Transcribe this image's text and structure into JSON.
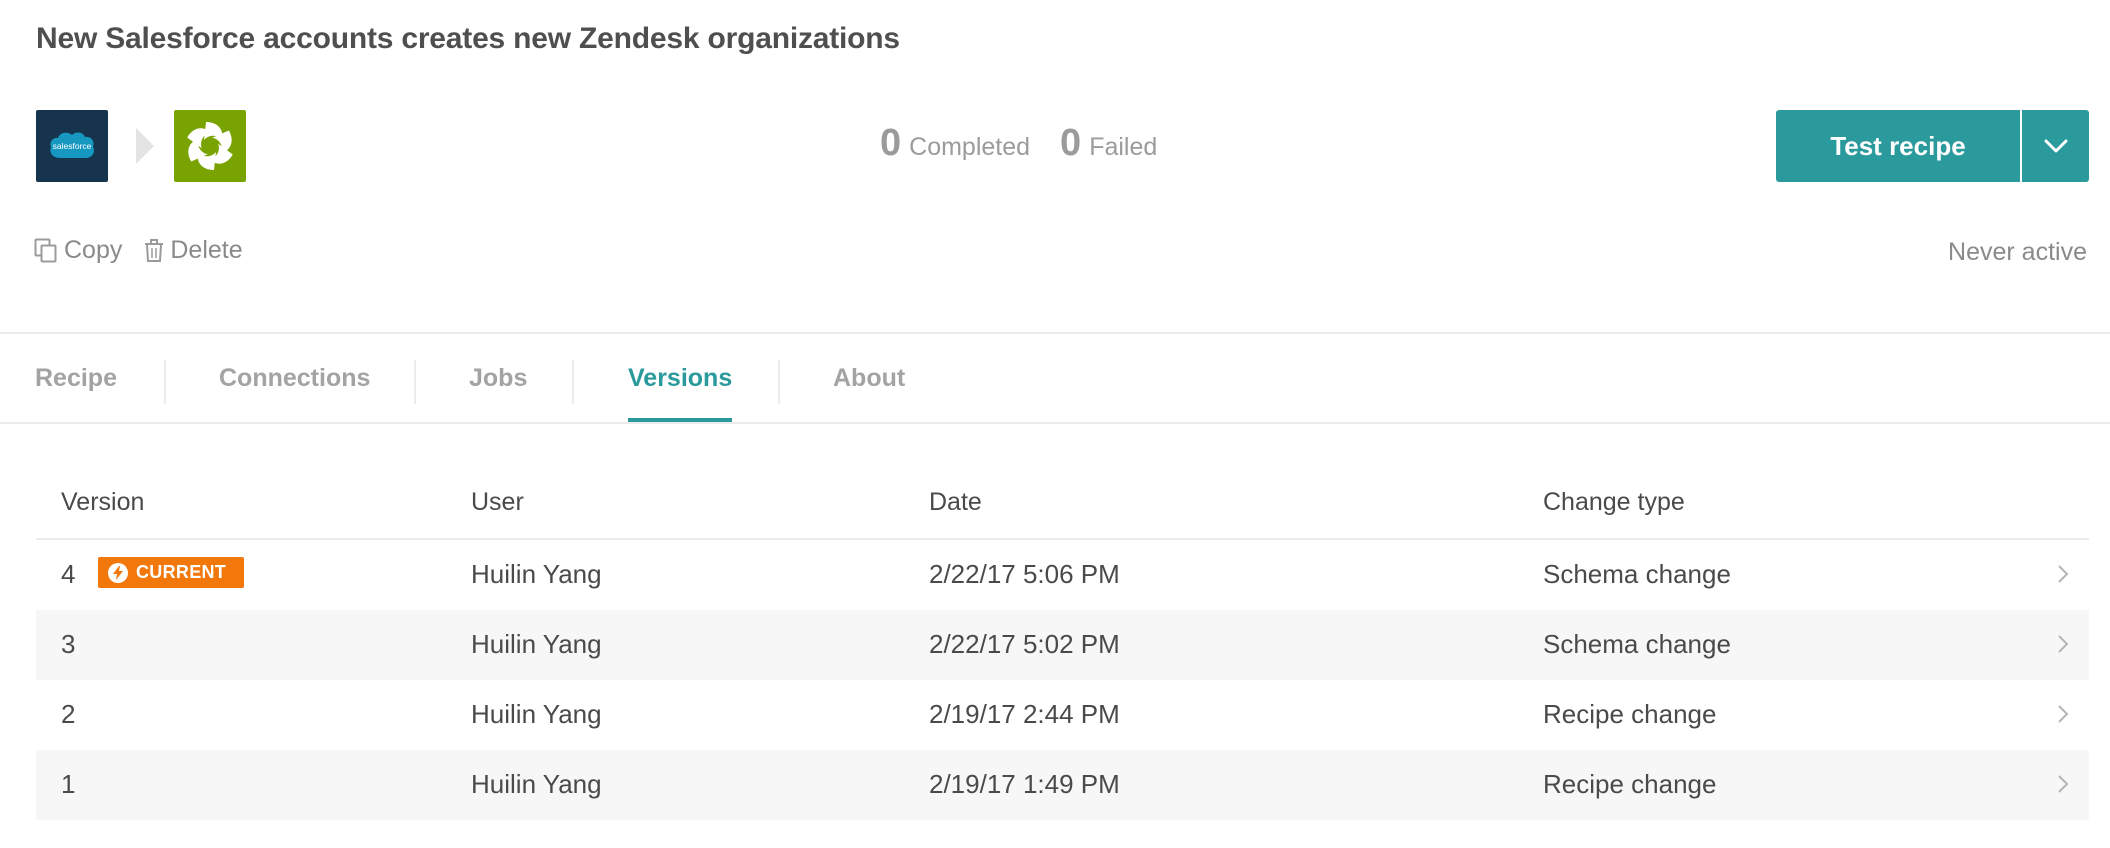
{
  "recipe": {
    "title": "New Salesforce accounts creates new Zendesk organizations",
    "apps": [
      {
        "name": "salesforce",
        "logo_text": "salesforce",
        "color": "#17344e"
      },
      {
        "name": "zendesk",
        "color": "#78a300"
      }
    ]
  },
  "stats": {
    "completed_count": "0",
    "completed_label": "Completed",
    "failed_count": "0",
    "failed_label": "Failed"
  },
  "toolbar": {
    "test_label": "Test recipe",
    "copy_label": "Copy",
    "delete_label": "Delete",
    "status": "Never active"
  },
  "tabs": [
    {
      "label": "Recipe"
    },
    {
      "label": "Connections"
    },
    {
      "label": "Jobs"
    },
    {
      "label": "Versions",
      "active": true
    },
    {
      "label": "About"
    }
  ],
  "versions_table": {
    "headers": {
      "version": "Version",
      "user": "User",
      "date": "Date",
      "change_type": "Change type"
    },
    "current_badge": "CURRENT",
    "rows": [
      {
        "version": "4",
        "user": "Huilin Yang",
        "date": "2/22/17 5:06 PM",
        "change_type": "Schema change",
        "current": true
      },
      {
        "version": "3",
        "user": "Huilin Yang",
        "date": "2/22/17 5:02 PM",
        "change_type": "Schema change"
      },
      {
        "version": "2",
        "user": "Huilin Yang",
        "date": "2/19/17 2:44 PM",
        "change_type": "Recipe change"
      },
      {
        "version": "1",
        "user": "Huilin Yang",
        "date": "2/19/17 1:49 PM",
        "change_type": "Recipe change"
      }
    ]
  },
  "colors": {
    "accent": "#2a9a9c",
    "badge": "#f2780c",
    "salesforce_tile": "#17344e",
    "zendesk_tile": "#78a300"
  },
  "icons": [
    "salesforce-logo",
    "zendesk-logo",
    "chevron-down-icon",
    "copy-icon",
    "trash-icon",
    "lightning-icon",
    "chevron-right-icon"
  ]
}
